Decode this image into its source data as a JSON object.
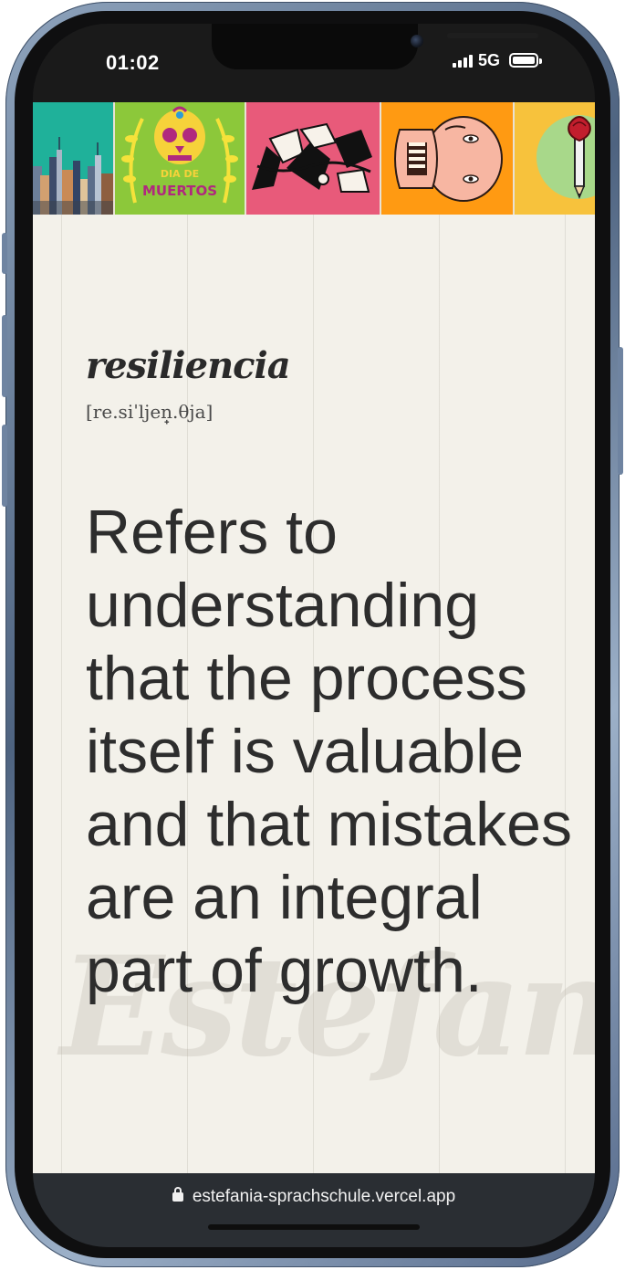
{
  "status_bar": {
    "time": "01:02",
    "network": "5G"
  },
  "banner": {
    "tiles": [
      {
        "name": "city-skyline",
        "color": "#1fb19a"
      },
      {
        "name": "dia-de-muertos",
        "color": "#8cc83a",
        "text_line1": "DIA DE",
        "text_line2": "MUERTOS"
      },
      {
        "name": "guernica",
        "color": "#e85a7a"
      },
      {
        "name": "dali-face",
        "color": "#ff9a12"
      },
      {
        "name": "rose-pencil",
        "color": "#f7c23c"
      }
    ]
  },
  "entry": {
    "word": "resiliencia",
    "pronunciation": "[re.siˈljen̟.θja]",
    "definition": "Refers to understanding that the process itself is valuable and that mistakes are an integral part of growth."
  },
  "watermark": "Estefanía",
  "browser": {
    "url": "estefania-sprachschule.vercel.app"
  }
}
